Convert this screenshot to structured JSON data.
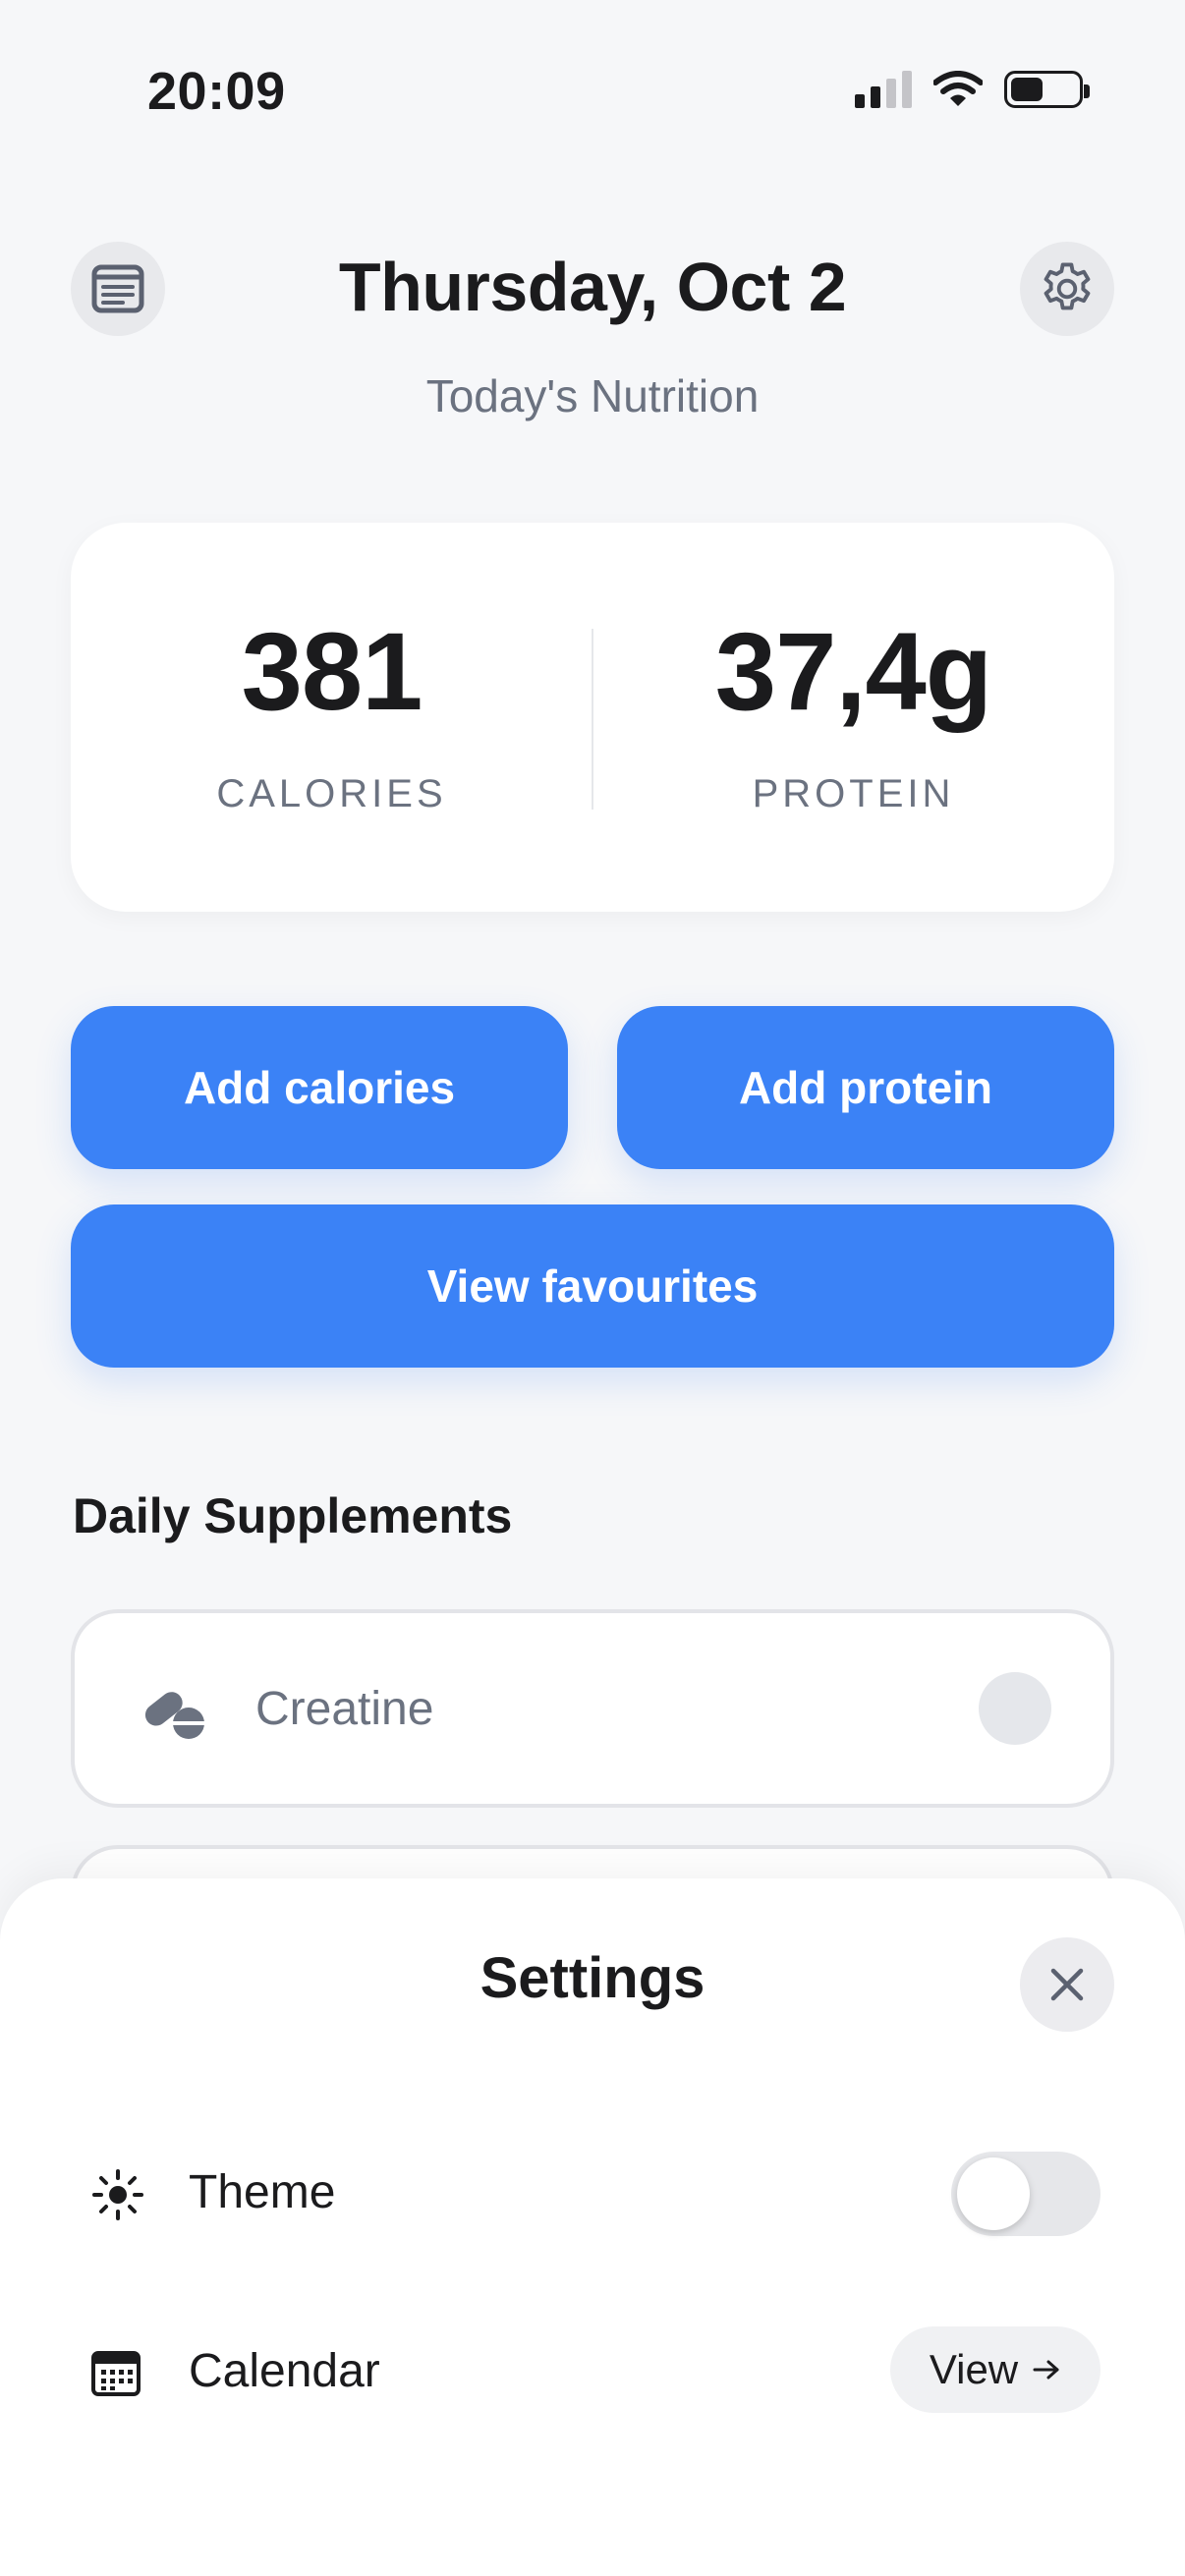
{
  "status_bar": {
    "time": "20:09",
    "battery_level": 0.48
  },
  "header": {
    "title": "Thursday, Oct 2",
    "subtitle": "Today's Nutrition",
    "left_icon": "list-icon",
    "right_icon": "gear-icon"
  },
  "stats": {
    "calories_value": "381",
    "calories_label": "CALORIES",
    "protein_value": "37,4g",
    "protein_label": "PROTEIN"
  },
  "actions": {
    "add_calories": "Add calories",
    "add_protein": "Add protein",
    "view_favourites": "View favourites"
  },
  "supplements": {
    "title": "Daily Supplements",
    "items": [
      {
        "name": "Creatine",
        "icon": "pills-icon",
        "checked": false
      }
    ]
  },
  "settings": {
    "title": "Settings",
    "theme": {
      "label": "Theme",
      "icon": "sun-icon",
      "enabled": false
    },
    "calendar": {
      "label": "Calendar",
      "icon": "calendar-icon",
      "button": "View",
      "button_icon": "arrow-right-icon"
    }
  },
  "colors": {
    "accent": "#3b82f6",
    "background": "#f6f7f9",
    "text": "#1b1b1d",
    "muted": "#6b7280"
  }
}
